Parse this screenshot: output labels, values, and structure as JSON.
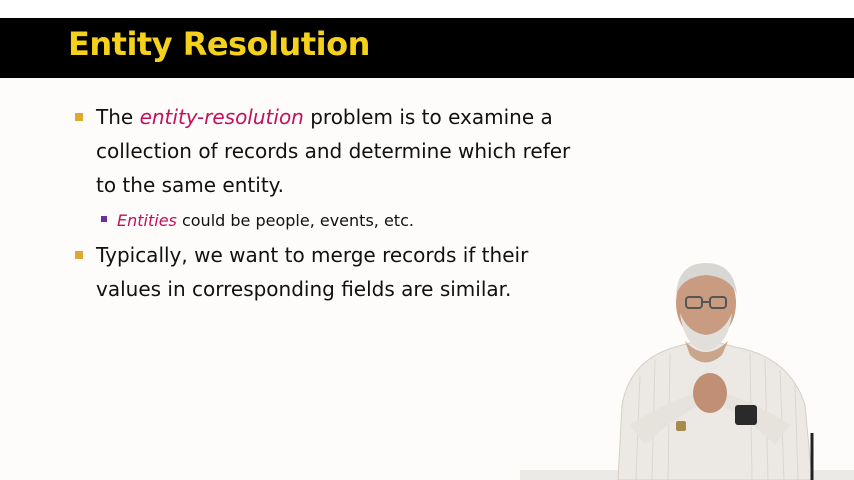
{
  "slide": {
    "title": "Entity Resolution",
    "bullets": [
      {
        "lines": [
          {
            "pre": "The ",
            "emphasis": "entity-resolution",
            "post": " problem is to examine a"
          },
          {
            "text": "collection of records and determine which refer"
          },
          {
            "text": "to the same entity."
          }
        ],
        "sub_bullets": [
          {
            "emphasis": "Entities",
            "post": " could be people, events, etc."
          }
        ]
      },
      {
        "lines": [
          {
            "text": "Typically, we want to merge records if their"
          },
          {
            "text": "values in corresponding fields are similar."
          }
        ]
      }
    ]
  },
  "colors": {
    "title_bar": "#000000",
    "title_text": "#f6d11c",
    "emphasis": "#c4105a",
    "bullet_level1": "#e0a82e",
    "bullet_level2": "#6b2fa0"
  },
  "presenter": {
    "icon": "presenter-figure"
  }
}
